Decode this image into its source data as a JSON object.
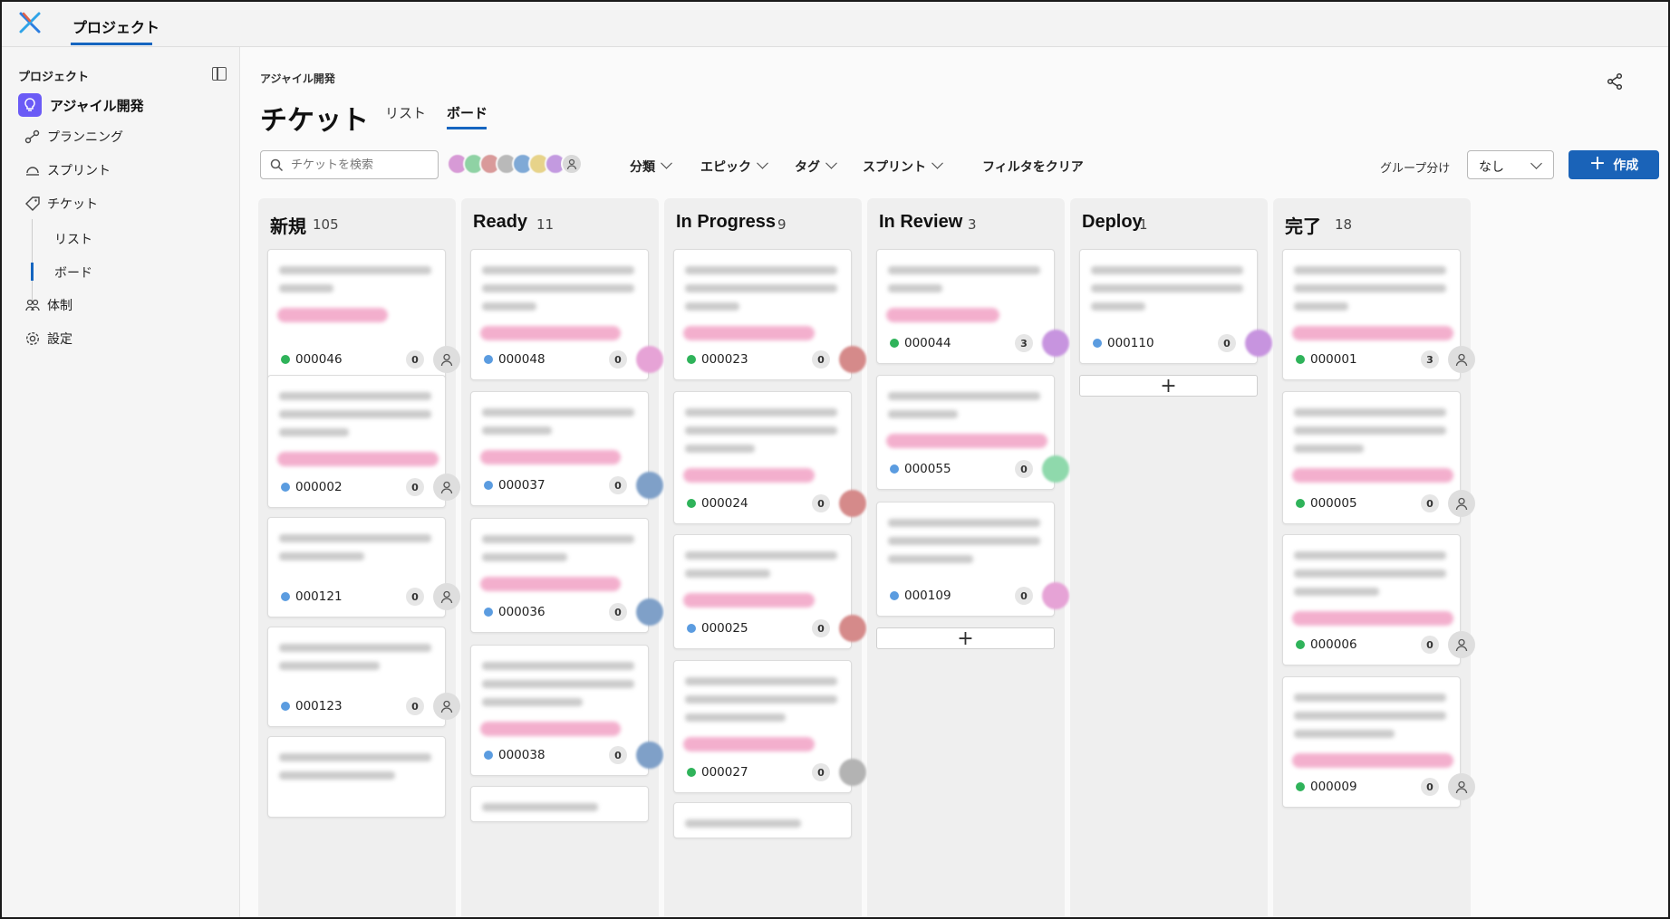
{
  "topbar": {
    "tab": "プロジェクト"
  },
  "sidebar": {
    "title": "プロジェクト",
    "project": "アジャイル開発",
    "items": [
      {
        "label": "プランニング",
        "icon": "planning-icon"
      },
      {
        "label": "スプリント",
        "icon": "sprint-icon"
      },
      {
        "label": "チケット",
        "icon": "ticket-icon"
      }
    ],
    "sub_items": [
      "リスト",
      "ボード"
    ],
    "items2": [
      {
        "label": "体制",
        "icon": "team-icon"
      },
      {
        "label": "設定",
        "icon": "gear-icon"
      }
    ]
  },
  "header": {
    "breadcrumb": "アジャイル開発",
    "title": "チケット",
    "tabs": [
      "リスト",
      "ボード"
    ],
    "active_tab": "ボード"
  },
  "toolbar": {
    "search_placeholder": "チケットを検索",
    "filters": [
      "分類",
      "エピック",
      "タグ",
      "スプリント"
    ],
    "clear_filter": "フィルタをクリア",
    "group_label": "グループ分け",
    "group_value": "なし",
    "create": "作成"
  },
  "colors": {
    "accent": "#1a63b8",
    "green": "#2fb35a",
    "blue": "#5b9ce0",
    "tag": "#f2a7c8"
  },
  "columns": [
    {
      "title": "新規",
      "count": "105",
      "cards": [
        {
          "id": "000046",
          "status": "green",
          "count": "0",
          "avatar": "generic"
        },
        {
          "id": "000002",
          "status": "blue",
          "count": "0",
          "avatar": "generic"
        },
        {
          "id": "000121",
          "status": "blue",
          "count": "0",
          "avatar": "generic"
        },
        {
          "id": "000123",
          "status": "blue",
          "count": "0",
          "avatar": "generic"
        }
      ]
    },
    {
      "title": "Ready",
      "count": "11",
      "cards": [
        {
          "id": "000048",
          "status": "blue",
          "count": "0",
          "avatar": "pink"
        },
        {
          "id": "000037",
          "status": "blue",
          "count": "0",
          "avatar": "steel"
        },
        {
          "id": "000036",
          "status": "blue",
          "count": "0",
          "avatar": "steel"
        },
        {
          "id": "000038",
          "status": "blue",
          "count": "0",
          "avatar": "steel"
        }
      ]
    },
    {
      "title": "In Progress",
      "count": "9",
      "cards": [
        {
          "id": "000023",
          "status": "green",
          "count": "0",
          "avatar": "red"
        },
        {
          "id": "000024",
          "status": "green",
          "count": "0",
          "avatar": "red"
        },
        {
          "id": "000025",
          "status": "blue",
          "count": "0",
          "avatar": "red"
        },
        {
          "id": "000027",
          "status": "green",
          "count": "0",
          "avatar": "gray"
        }
      ]
    },
    {
      "title": "In Review",
      "count": "3",
      "cards": [
        {
          "id": "000044",
          "status": "green",
          "count": "3",
          "avatar": "purple"
        },
        {
          "id": "000055",
          "status": "blue",
          "count": "0",
          "avatar": "mint"
        },
        {
          "id": "000109",
          "status": "blue",
          "count": "0",
          "avatar": "pink"
        }
      ]
    },
    {
      "title": "Deploy",
      "count": "1",
      "cards": [
        {
          "id": "000110",
          "status": "blue",
          "count": "0",
          "avatar": "purple"
        }
      ]
    },
    {
      "title": "完了",
      "count": "18",
      "cards": [
        {
          "id": "000001",
          "status": "green",
          "count": "3",
          "avatar": "generic"
        },
        {
          "id": "000005",
          "status": "green",
          "count": "0",
          "avatar": "generic"
        },
        {
          "id": "000006",
          "status": "green",
          "count": "0",
          "avatar": "generic"
        },
        {
          "id": "000009",
          "status": "green",
          "count": "0",
          "avatar": "generic"
        }
      ]
    }
  ]
}
